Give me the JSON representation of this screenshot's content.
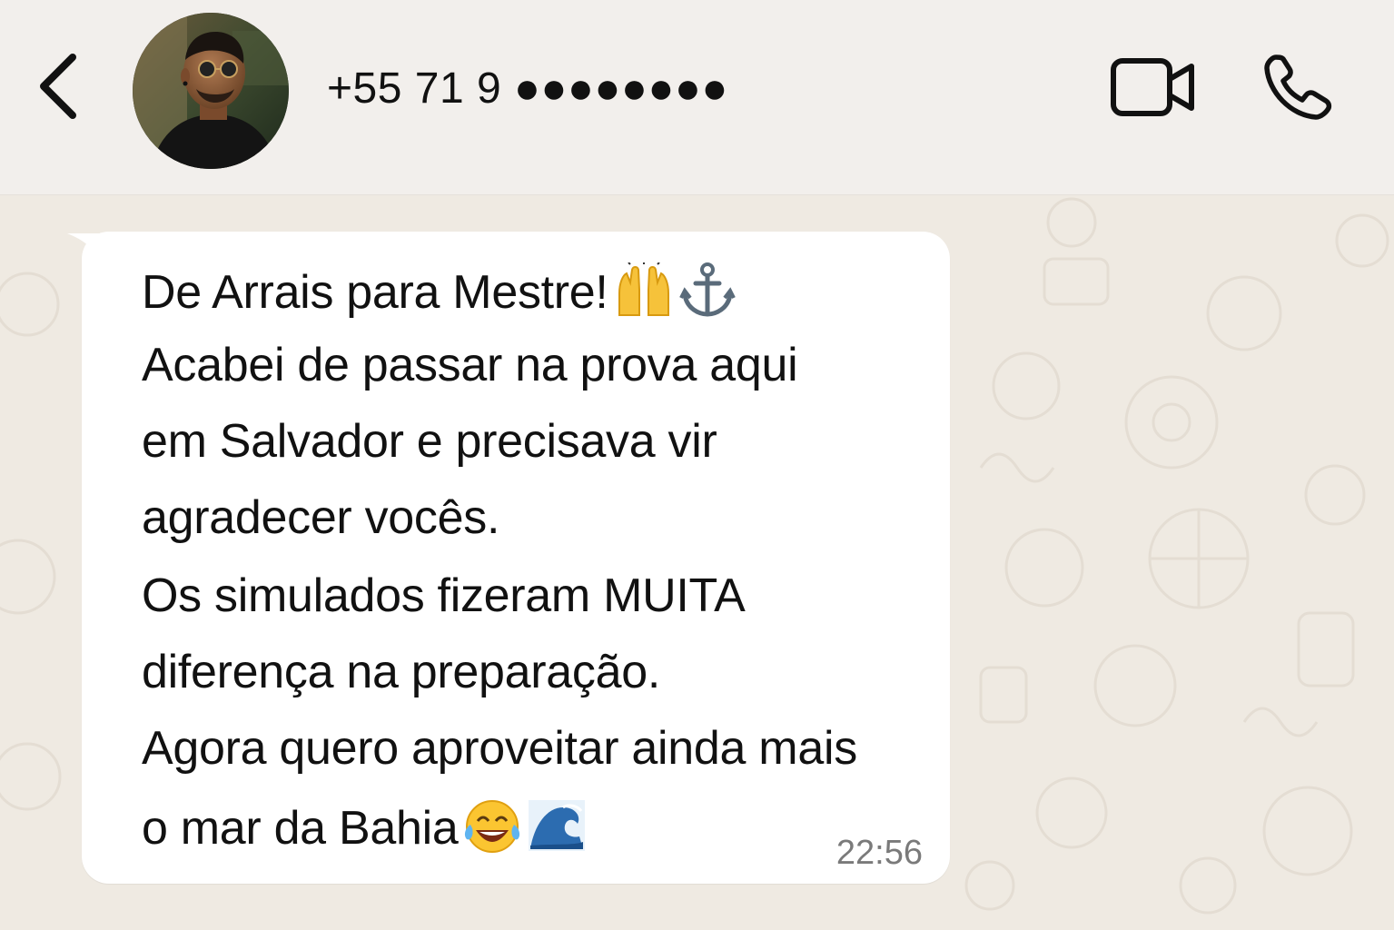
{
  "header": {
    "back_label": "Back",
    "contact_name": "+55 71 9 ●●●●●●●●",
    "icons": {
      "back": "chevron-left-icon",
      "video": "video-camera-icon",
      "call": "phone-icon"
    }
  },
  "message": {
    "lines": [
      "De Arrais para Mestre!",
      "Acabei de passar na prova aqui",
      "em Salvador e precisava vir",
      "agradecer vocês.",
      "Os simulados fizeram MUITA",
      "diferença na preparação.",
      "Agora quero aproveitar ainda mais",
      "o mar da Bahia"
    ],
    "line1_emojis": [
      "raising-hands-emoji",
      "anchor-emoji"
    ],
    "line8_emojis": [
      "tears-of-joy-emoji",
      "water-wave-emoji"
    ],
    "time": "22:56"
  },
  "colors": {
    "header_bg": "#f2efec",
    "chat_bg": "#efeae2",
    "bubble_bg": "#ffffff",
    "text": "#111111",
    "timestamp": "#7a7a7a"
  }
}
